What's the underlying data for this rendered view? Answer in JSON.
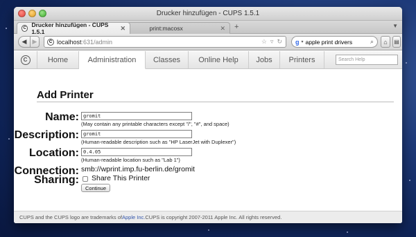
{
  "window": {
    "title": "Drucker hinzufügen - CUPS 1.5.1"
  },
  "tabs": [
    {
      "label": "Drucker hinzufügen - CUPS 1.5.1",
      "active": true
    },
    {
      "label": "print:macosx",
      "active": false
    }
  ],
  "toolbar": {
    "url_host": "localhost",
    "url_rest": ":631/admin",
    "search_value": "apple print drivers"
  },
  "cups_nav": {
    "items": [
      "Home",
      "Administration",
      "Classes",
      "Online Help",
      "Jobs",
      "Printers"
    ],
    "active": "Administration",
    "search_placeholder": "Search Help"
  },
  "page": {
    "title": "Add Printer",
    "name_label": "Name:",
    "name_value": "gromit",
    "name_hint": "(May contain any printable characters except \"/\", \"#\", and space)",
    "description_label": "Description:",
    "description_value": "gromit",
    "description_hint": "(Human-readable description such as \"HP LaserJet with Duplexer\")",
    "location_label": "Location:",
    "location_value": "0.4.05",
    "location_hint": "(Human-readable location such as \"Lab 1\")",
    "connection_label": "Connection:",
    "connection_value": "smb://wprint.imp.fu-berlin.de/gromit",
    "sharing_label": "Sharing:",
    "share_checkbox_label": "Share This Printer",
    "share_checked": false,
    "continue_label": "Continue"
  },
  "footer": {
    "text_before": "CUPS and the CUPS logo are trademarks of ",
    "link": "Apple Inc.",
    "text_after": " CUPS is copyright 2007-2011 Apple Inc. All rights reserved."
  }
}
